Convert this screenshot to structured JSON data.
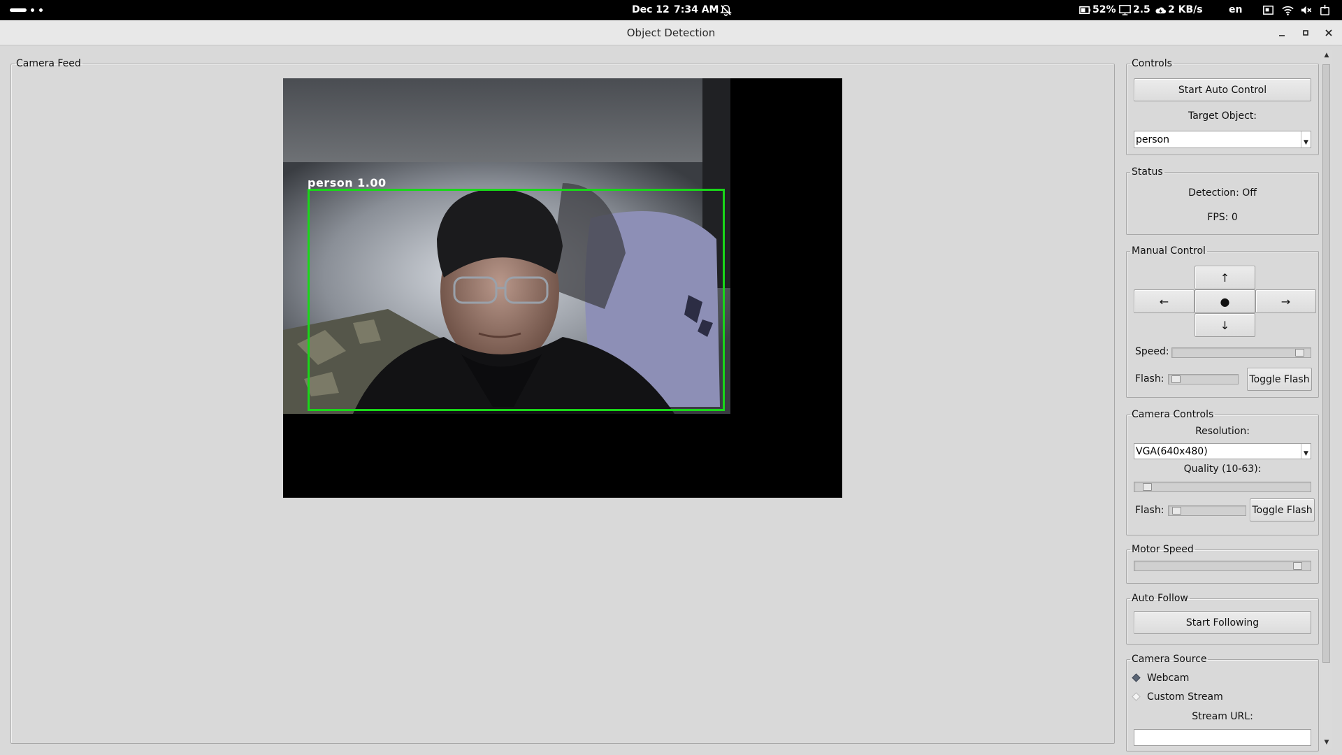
{
  "system_bar": {
    "date": "Dec 12",
    "time": "7:34 AM",
    "battery": "52%",
    "cpu": "2.5",
    "network": "2 KB/s",
    "language": "en",
    "icons": [
      "activities-dots",
      "notifications-muted-icon",
      "battery-icon",
      "monitor-icon",
      "cloud-icon",
      "screenshot-icon",
      "wifi-icon",
      "speaker-muted-icon",
      "power-icon"
    ]
  },
  "window": {
    "title": "Object Detection"
  },
  "camera_feed": {
    "title": "Camera Feed",
    "detection_label": "person 1.00",
    "box_color": "#19d619"
  },
  "controls": {
    "title": "Controls",
    "start_auto_label": "Start Auto Control",
    "target_label": "Target Object:",
    "target_value": "person"
  },
  "status": {
    "title": "Status",
    "detection": "Detection: Off",
    "fps": "FPS: 0"
  },
  "manual_control": {
    "title": "Manual Control",
    "up": "↑",
    "left": "←",
    "stop": "●",
    "right": "→",
    "down": "↓",
    "speed_label": "Speed:",
    "speed_level": 0.95,
    "flash_label": "Flash:",
    "flash_level": 0.05,
    "toggle_flash": "Toggle Flash"
  },
  "camera_controls": {
    "title": "Camera Controls",
    "resolution_label": "Resolution:",
    "resolution_value": "VGA(640x480)",
    "quality_label": "Quality (10-63):",
    "quality_level": 0.05,
    "flash_label": "Flash:",
    "flash_level": 0.05,
    "toggle_flash": "Toggle Flash"
  },
  "motor_speed": {
    "title": "Motor Speed",
    "level": 0.95
  },
  "auto_follow": {
    "title": "Auto Follow",
    "start_following": "Start Following"
  },
  "camera_source": {
    "title": "Camera Source",
    "webcam": "Webcam",
    "custom_stream": "Custom Stream",
    "selected": "Webcam",
    "stream_url_label": "Stream URL:",
    "stream_url_value": ""
  }
}
